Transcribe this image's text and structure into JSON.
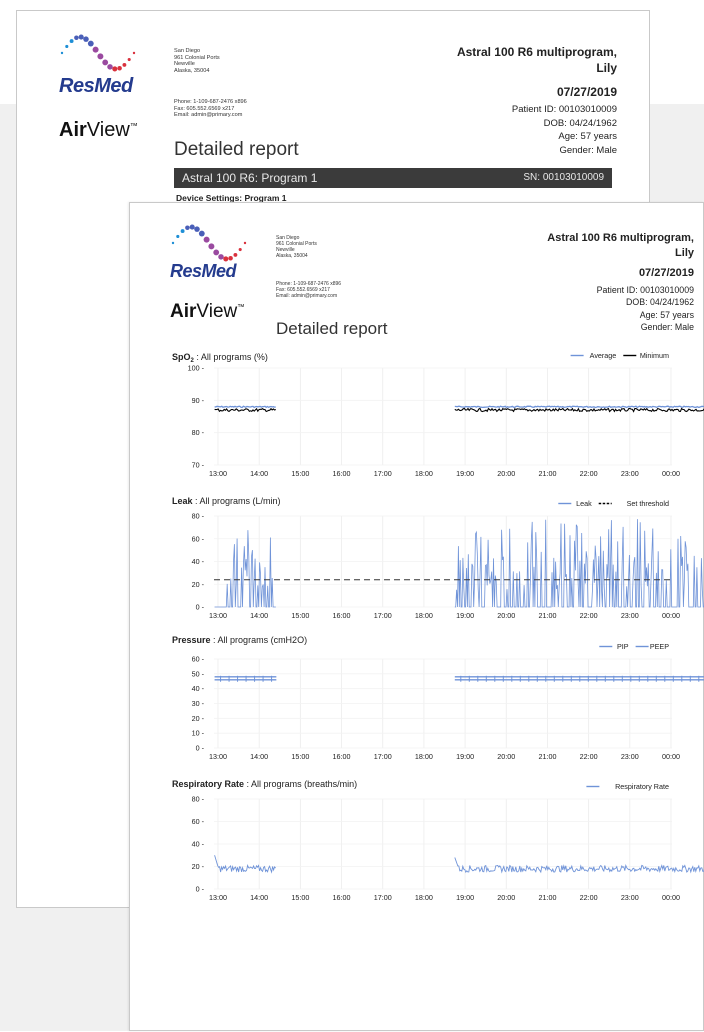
{
  "company": {
    "brand": "ResMed",
    "product_prefix": "Air",
    "product_suffix": "View",
    "tm": "™",
    "address": [
      "San Diego",
      "961 Colonial Ports",
      "Newville",
      "Alaska, 35004"
    ],
    "contact": [
      "Phone: 1-109-687-2476 x896",
      "Fax: 605.552.6569 x217",
      "Email: admin@primary.com"
    ]
  },
  "report": {
    "device_line1": "Astral 100 R6 multiprogram,",
    "device_line2": "Lily",
    "date": "07/27/2019",
    "patient_id": "Patient ID: 00103010009",
    "dob": "DOB: 04/24/1962",
    "age": "Age: 57 years",
    "gender": "Gender: Male",
    "title": "Detailed report",
    "program_bar": "Astral 100 R6: Program 1",
    "serial": "SN: 00103010009",
    "settings_label": "Device Settings: Program 1"
  },
  "colors": {
    "series_blue": "#6f93d8",
    "black": "#000000",
    "bar_bg": "#3b3b3b"
  },
  "x_ticks": [
    "13:00",
    "14:00",
    "15:00",
    "16:00",
    "17:00",
    "18:00",
    "19:00",
    "20:00",
    "21:00",
    "22:00",
    "23:00",
    "00:00"
  ],
  "chart_data": [
    {
      "type": "line",
      "title": "SpO",
      "title_sub": "2",
      "title_rest": ": All programs (%)",
      "legend": [
        "Average",
        "Minimum"
      ],
      "legend_placement": "top-right",
      "y_ticks": [
        "100",
        "90",
        "80",
        "70"
      ],
      "ylim": [
        70,
        100
      ],
      "series": [
        {
          "name": "Average",
          "color": "#6f93d8",
          "segments": [
            {
              "start": "12:55",
              "end": "14:25",
              "values": [
                88
              ]
            },
            {
              "start": "18:45",
              "end": "00:55",
              "values": [
                88
              ]
            }
          ]
        },
        {
          "name": "Minimum",
          "color": "#000000",
          "segments": [
            {
              "start": "12:55",
              "end": "14:25",
              "values": [
                87
              ]
            },
            {
              "start": "18:45",
              "end": "00:55",
              "values": [
                87
              ]
            }
          ]
        }
      ]
    },
    {
      "type": "line",
      "title": "Leak",
      "title_rest": ": All programs (L/min)",
      "legend": [
        "Leak",
        "Set threshold"
      ],
      "legend_placement": "top-right",
      "y_ticks": [
        "80",
        "60",
        "40",
        "20",
        "0"
      ],
      "ylim": [
        0,
        80
      ],
      "threshold": 24,
      "series": [
        {
          "name": "Leak",
          "color": "#6f93d8",
          "segments": [
            {
              "start": "12:55",
              "end": "14:25"
            },
            {
              "start": "18:45",
              "end": "00:55"
            }
          ],
          "range": [
            0,
            80
          ]
        }
      ]
    },
    {
      "type": "line",
      "title": "Pressure",
      "title_rest": ": All programs (cmH2O)",
      "legend": [
        "PIP",
        "PEEP"
      ],
      "legend_placement": "top-right",
      "y_ticks": [
        "60",
        "50",
        "40",
        "30",
        "20",
        "10",
        "0"
      ],
      "ylim": [
        0,
        60
      ],
      "series": [
        {
          "name": "PIP",
          "color": "#6f93d8",
          "segments": [
            {
              "start": "12:55",
              "end": "14:25",
              "values": [
                48
              ]
            },
            {
              "start": "18:45",
              "end": "00:55",
              "values": [
                48
              ]
            }
          ]
        },
        {
          "name": "PEEP",
          "color": "#6f93d8",
          "segments": [
            {
              "start": "12:55",
              "end": "14:25",
              "values": [
                46
              ]
            },
            {
              "start": "18:45",
              "end": "00:55",
              "values": [
                46
              ]
            }
          ]
        }
      ]
    },
    {
      "type": "line",
      "title": "Respiratory Rate",
      "title_rest": ": All programs (breaths/min)",
      "legend": [
        "Respiratory Rate"
      ],
      "legend_placement": "top-right",
      "y_ticks": [
        "80",
        "60",
        "40",
        "20",
        "0"
      ],
      "ylim": [
        0,
        80
      ],
      "series": [
        {
          "name": "Respiratory Rate",
          "color": "#6f93d8",
          "segments": [
            {
              "start": "12:55",
              "end": "14:25",
              "values": [
                18
              ],
              "peak": 30
            },
            {
              "start": "18:45",
              "end": "00:55",
              "values": [
                18
              ],
              "peak": 28
            }
          ]
        }
      ]
    }
  ]
}
